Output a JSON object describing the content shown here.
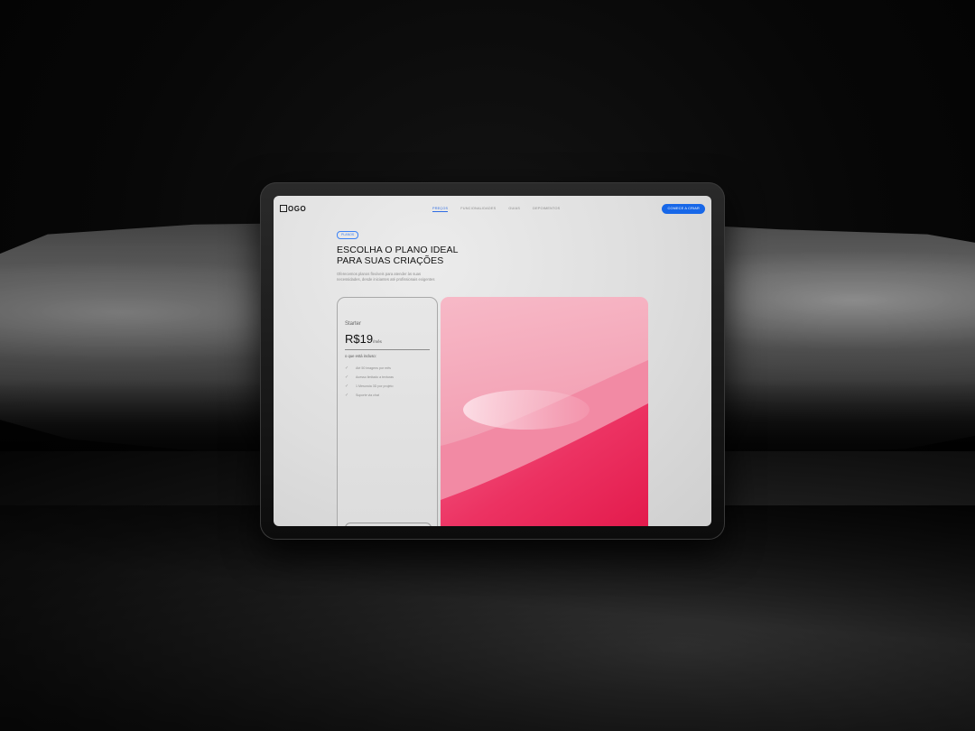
{
  "nav": {
    "logo": "OGO",
    "links": [
      "PREÇOS",
      "FUNCIONALIDADES",
      "GUIAS",
      "DEPOIMENTOS"
    ],
    "active_link": "PREÇOS",
    "cta": "COMECE A CRIAR"
  },
  "hero": {
    "badge": "PLANOS",
    "headline_line1": "ESCOLHA O PLANO IDEAL",
    "headline_line2": "PARA SUAS CRIAÇÕES",
    "subtitle_line1": "Oferecemos planos flexíveis para atender às suas",
    "subtitle_line2": "necessidades, desde iniciantes até profissionais exigentes"
  },
  "plan": {
    "name": "Starter",
    "price": "R$19",
    "period": "/mês",
    "includes_title": "o que está incluso:",
    "features": [
      "Até 50 imagens por mês",
      "Acesso limitado a texturas",
      "1 Mesoroia 3D por projeto",
      "Suporte via chat"
    ]
  },
  "icons": {
    "check": "check-icon"
  },
  "colors": {
    "accent": "#1767e8",
    "image_pink": "#e8204f",
    "image_light_pink": "#f5a9bb"
  }
}
